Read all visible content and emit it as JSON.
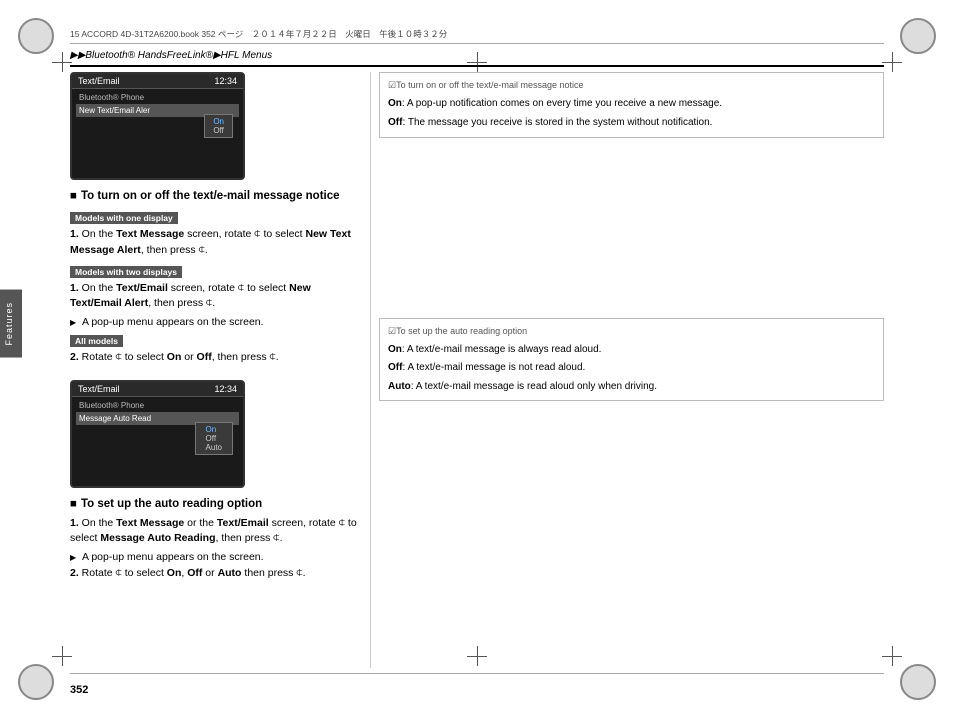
{
  "page": {
    "number": "352",
    "file_bar": "15 ACCORD 4D-31T2A6200.book  352 ページ　２０１４年７月２２日　火曜日　午後１０時３２分",
    "breadcrumb": "▶▶Bluetooth® HandsFreeLink®▶HFL Menus"
  },
  "side_tab": "Features",
  "screen1": {
    "title": "Text/Email",
    "time": "12:34",
    "items": [
      {
        "label": "New Text/Email Aler",
        "highlighted": true
      },
      {
        "label": "Off",
        "highlighted": false
      }
    ],
    "submenu": []
  },
  "screen2": {
    "title": "Text/Email",
    "time": "12:34",
    "items": [
      {
        "label": "Message Auto Read",
        "highlighted": true
      }
    ],
    "submenu": [
      {
        "label": "On",
        "active": true
      },
      {
        "label": "Off",
        "active": false
      },
      {
        "label": "Auto",
        "active": false
      }
    ]
  },
  "section1": {
    "title": "To turn on or off the text/e-mail message notice",
    "badge1": "Models with one display",
    "step1": "1. On the Text Message screen, rotate ⌀ to select New Text Message Alert, then press ⌀.",
    "badge2": "Models with two displays",
    "step2a": "1. On the Text/Email screen, rotate ⌀ to select New Text/Email Alert, then press ⌀.",
    "step2b": "A pop-up menu appears on the screen.",
    "badge3": "All models",
    "step3": "2. Rotate ⌀ to select On or Off, then press ⌀."
  },
  "section2": {
    "title": "To set up the auto reading option",
    "step1": "1. On the Text Message or the Text/Email screen, rotate ⌀ to select Message Auto Reading, then press ⌀.",
    "step1b": "A pop-up menu appears on the screen.",
    "step2": "2. Rotate ⌀ to select On, Off or Auto then press ⌀."
  },
  "info1": {
    "title": "☑To turn on or off the text/e-mail message notice",
    "on_label": "On",
    "on_text": ": A pop-up notification comes on every time you receive a new message.",
    "off_label": "Off",
    "off_text": ": The message you receive is stored in the system without notification."
  },
  "info2": {
    "title": "☑To set up the auto reading option",
    "on_label": "On",
    "on_text": ": A text/e-mail message is always read aloud.",
    "off_label": "Off",
    "off_text": ": A text/e-mail message is not read aloud.",
    "auto_label": "Auto",
    "auto_text": ": A text/e-mail message is read aloud only when driving."
  }
}
